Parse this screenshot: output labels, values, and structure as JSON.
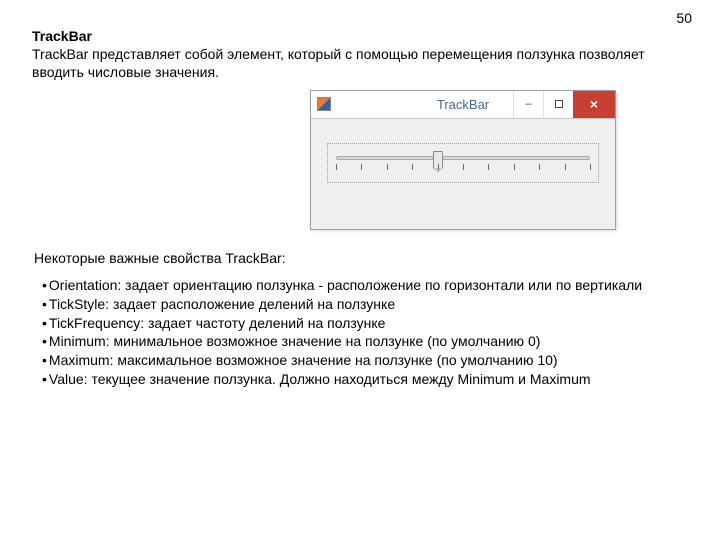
{
  "page_number": "50",
  "heading": "TrackBar",
  "intro": "TrackBar представляет собой элемент, который с помощью перемещения ползунка позволяет вводить числовые значения.",
  "window": {
    "title": "TrackBar",
    "trackbar": {
      "ticks": 11,
      "value_index": 4
    }
  },
  "subheading": "Некоторые важные свойства TrackBar:",
  "bullets": [
    "Orientation: задает ориентацию ползунка - расположение по горизонтали или по вертикали",
    "TickStyle: задает расположение делений на ползунке",
    "TickFrequency: задает частоту делений на ползунке",
    "Minimum: минимальное возможное значение на ползунке (по умолчанию 0)",
    "Maximum: максимальное возможное значение на ползунке (по умолчанию 10)",
    "Value: текущее значение ползунка. Должно находиться между Minimum и Maximum"
  ]
}
